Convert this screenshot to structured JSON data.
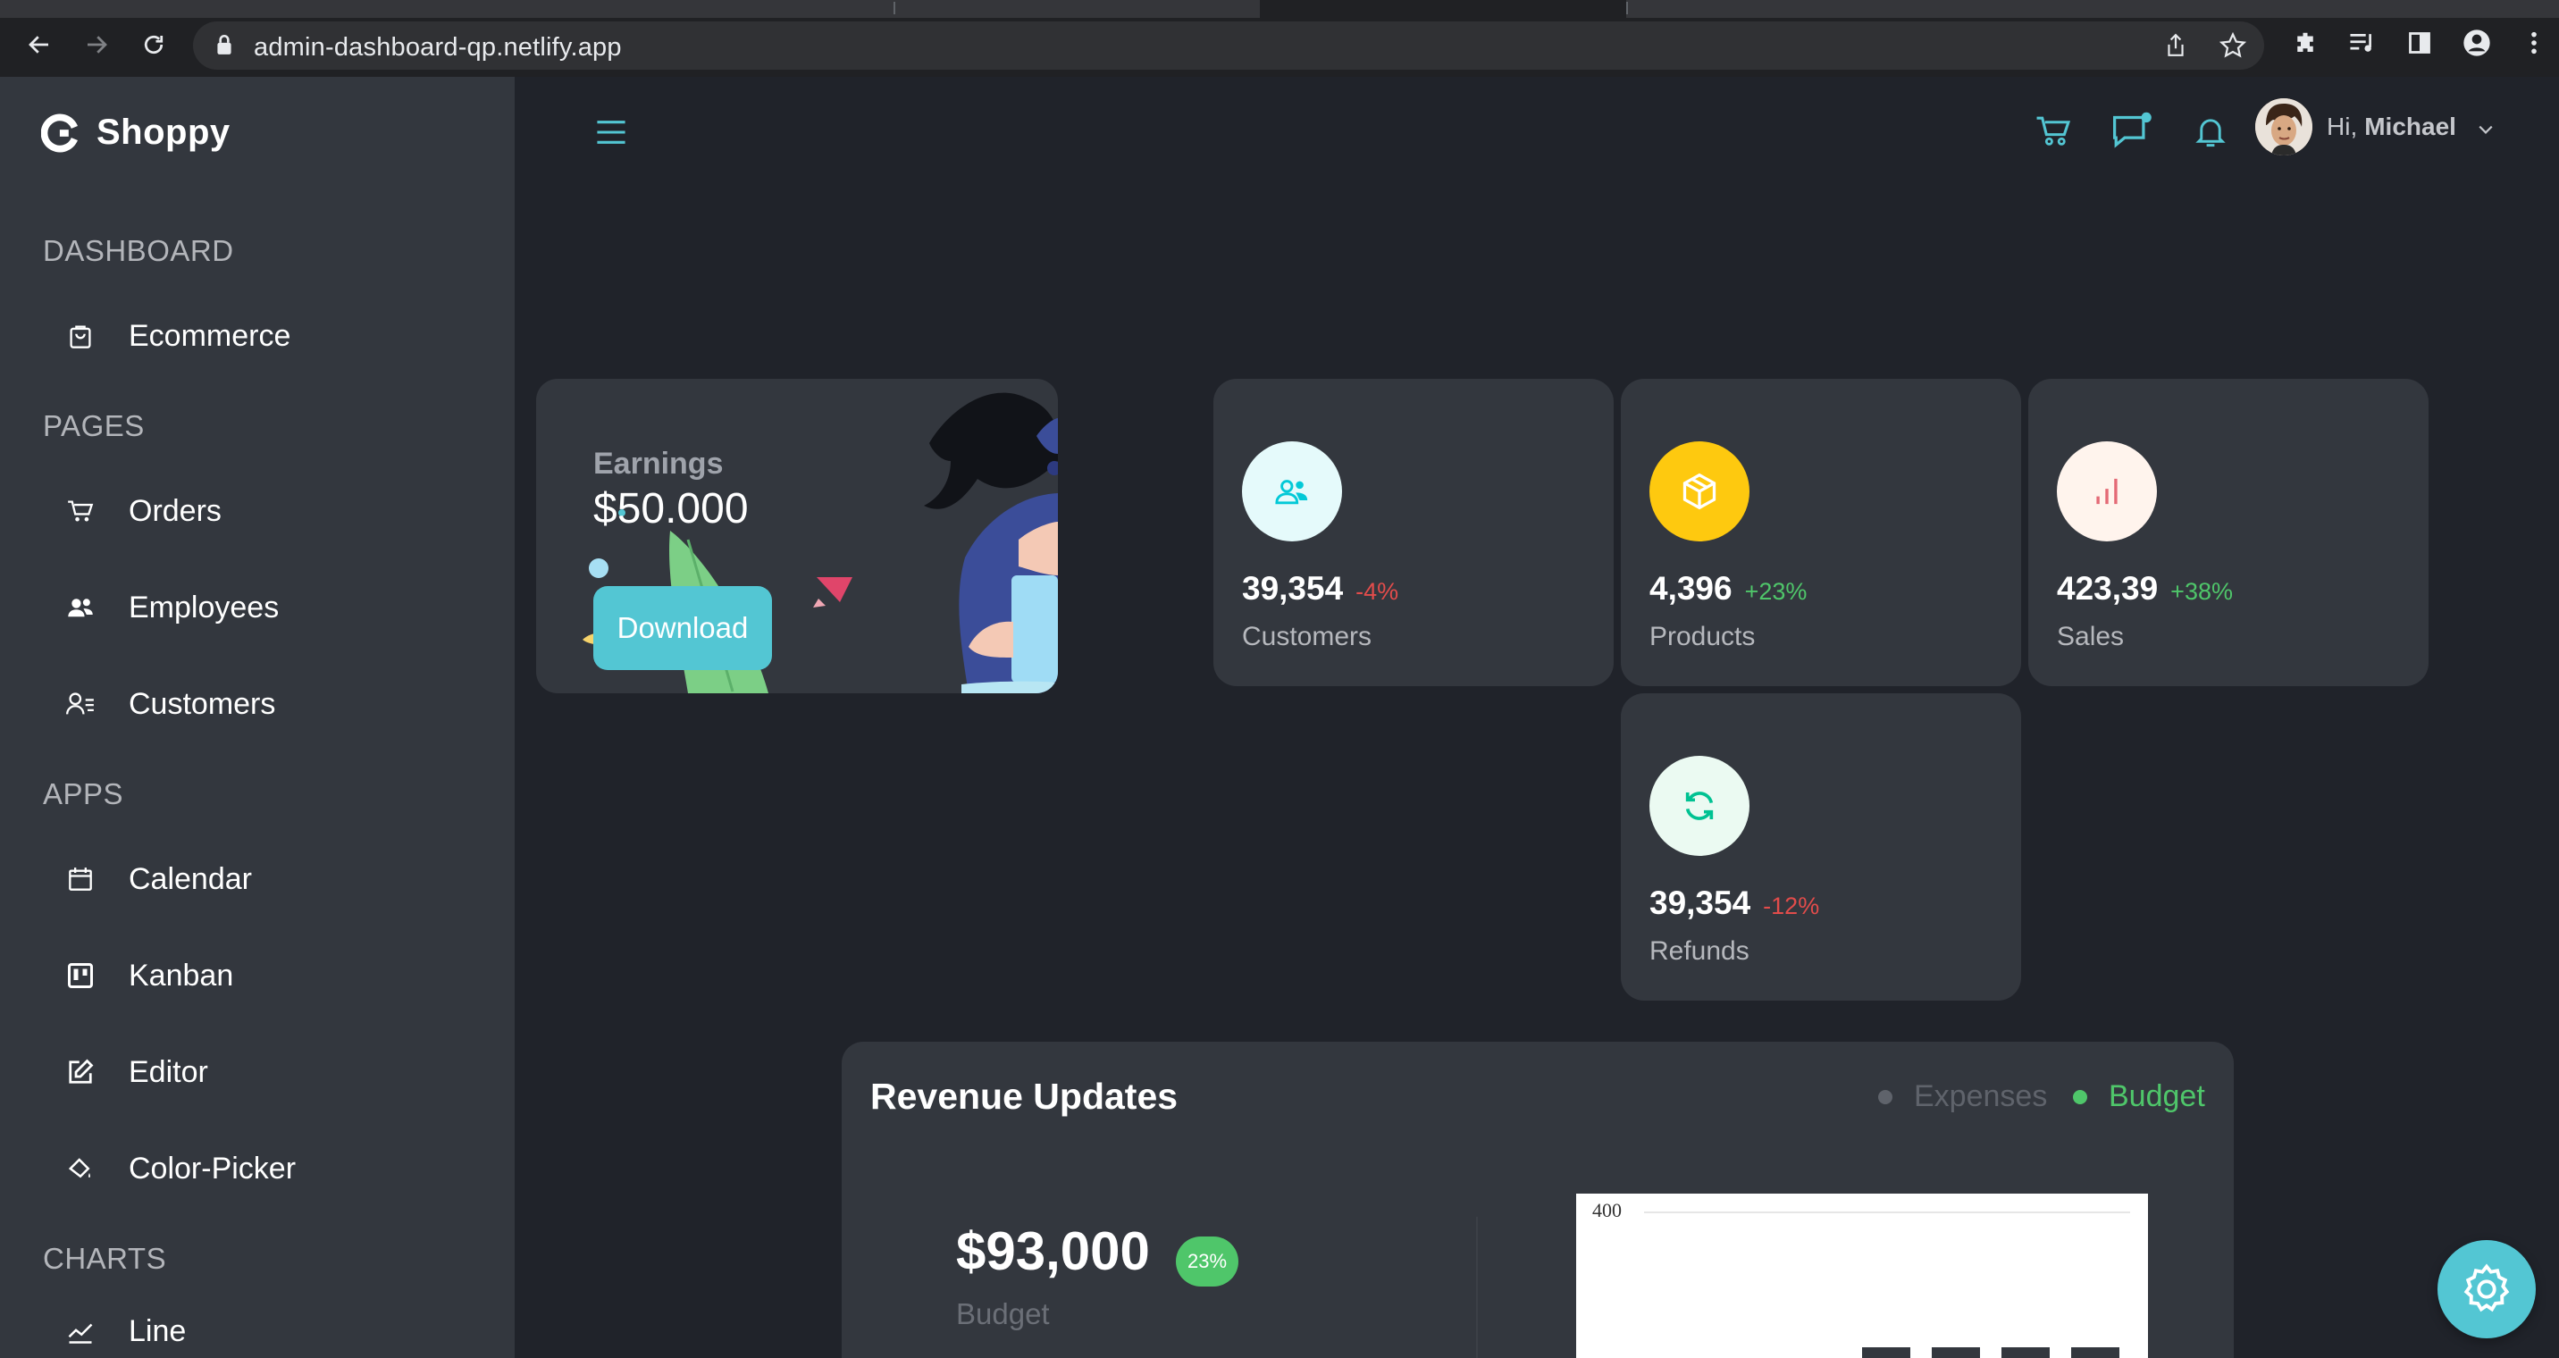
{
  "browser": {
    "url": "admin-dashboard-qp.netlify.app"
  },
  "sidebar": {
    "brand": "Shoppy",
    "sections": [
      {
        "title": "DASHBOARD",
        "items": [
          {
            "label": "Ecommerce",
            "icon": "shopping-bag-icon"
          }
        ]
      },
      {
        "title": "PAGES",
        "items": [
          {
            "label": "Orders",
            "icon": "cart-icon"
          },
          {
            "label": "Employees",
            "icon": "people-icon"
          },
          {
            "label": "Customers",
            "icon": "user-list-icon"
          }
        ]
      },
      {
        "title": "APPS",
        "items": [
          {
            "label": "Calendar",
            "icon": "calendar-icon"
          },
          {
            "label": "Kanban",
            "icon": "kanban-icon"
          },
          {
            "label": "Editor",
            "icon": "edit-icon"
          },
          {
            "label": "Color-Picker",
            "icon": "paint-bucket-icon"
          }
        ]
      },
      {
        "title": "CHARTS",
        "items": [
          {
            "label": "Line",
            "icon": "line-chart-icon"
          }
        ]
      }
    ]
  },
  "topnav": {
    "greeting": "Hi,",
    "user_name": "Michael"
  },
  "earnings": {
    "label": "Earnings",
    "amount": "$50.000",
    "button": "Download"
  },
  "stats": [
    {
      "value": "39,354",
      "percent": "-4%",
      "name": "Customers",
      "icon": "people-icon",
      "icon_bg": "#e5fafb",
      "icon_color": "#03c9d7",
      "pct_color": "#e24c4b"
    },
    {
      "value": "4,396",
      "percent": "+23%",
      "name": "Products",
      "icon": "box-icon",
      "icon_bg": "#fec90f",
      "icon_color": "#ffffff",
      "pct_color": "#4fc66a"
    },
    {
      "value": "423,39",
      "percent": "+38%",
      "name": "Sales",
      "icon": "bar-chart-icon",
      "icon_bg": "#fff4ed",
      "icon_color": "#e46a76",
      "pct_color": "#4fc66a"
    },
    {
      "value": "39,354",
      "percent": "-12%",
      "name": "Refunds",
      "icon": "refresh-icon",
      "icon_bg": "#ebfaf2",
      "icon_color": "#00c292",
      "pct_color": "#e24c4b"
    }
  ],
  "revenue": {
    "title": "Revenue Updates",
    "legend": [
      {
        "label": "Expenses",
        "color": "#5f636b"
      },
      {
        "label": "Budget",
        "color": "#4fc66a"
      }
    ],
    "budget_amount": "$93,000",
    "budget_badge": "23%",
    "budget_label": "Budget",
    "chart_tick": "400"
  }
}
